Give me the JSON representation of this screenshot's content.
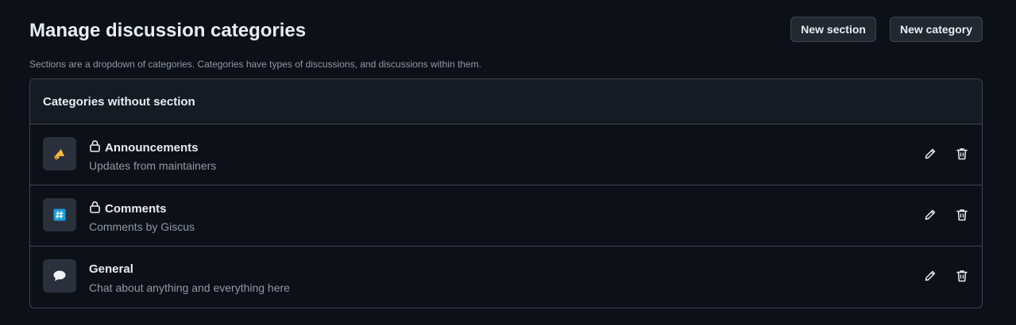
{
  "header": {
    "title": "Manage discussion categories",
    "new_section_label": "New section",
    "new_category_label": "New category",
    "subtitle": "Sections are a dropdown of categories. Categories have types of discussions, and discussions within them."
  },
  "box": {
    "title": "Categories without section",
    "categories": [
      {
        "name": "Announcements",
        "description": "Updates from maintainers",
        "locked": true,
        "icon": "megaphone-emoji-icon"
      },
      {
        "name": "Comments",
        "description": "Comments by Giscus",
        "locked": true,
        "icon": "hash-emoji-icon"
      },
      {
        "name": "General",
        "description": "Chat about anything and everything here",
        "locked": false,
        "icon": "speech-bubble-emoji-icon"
      }
    ]
  },
  "colors": {
    "background": "#0d1117",
    "header_bg": "#151b23",
    "border": "#3d444d",
    "muted_text": "#9198a1",
    "accent_yellow": "#f4b93e",
    "accent_blue": "#1d9bd7"
  }
}
